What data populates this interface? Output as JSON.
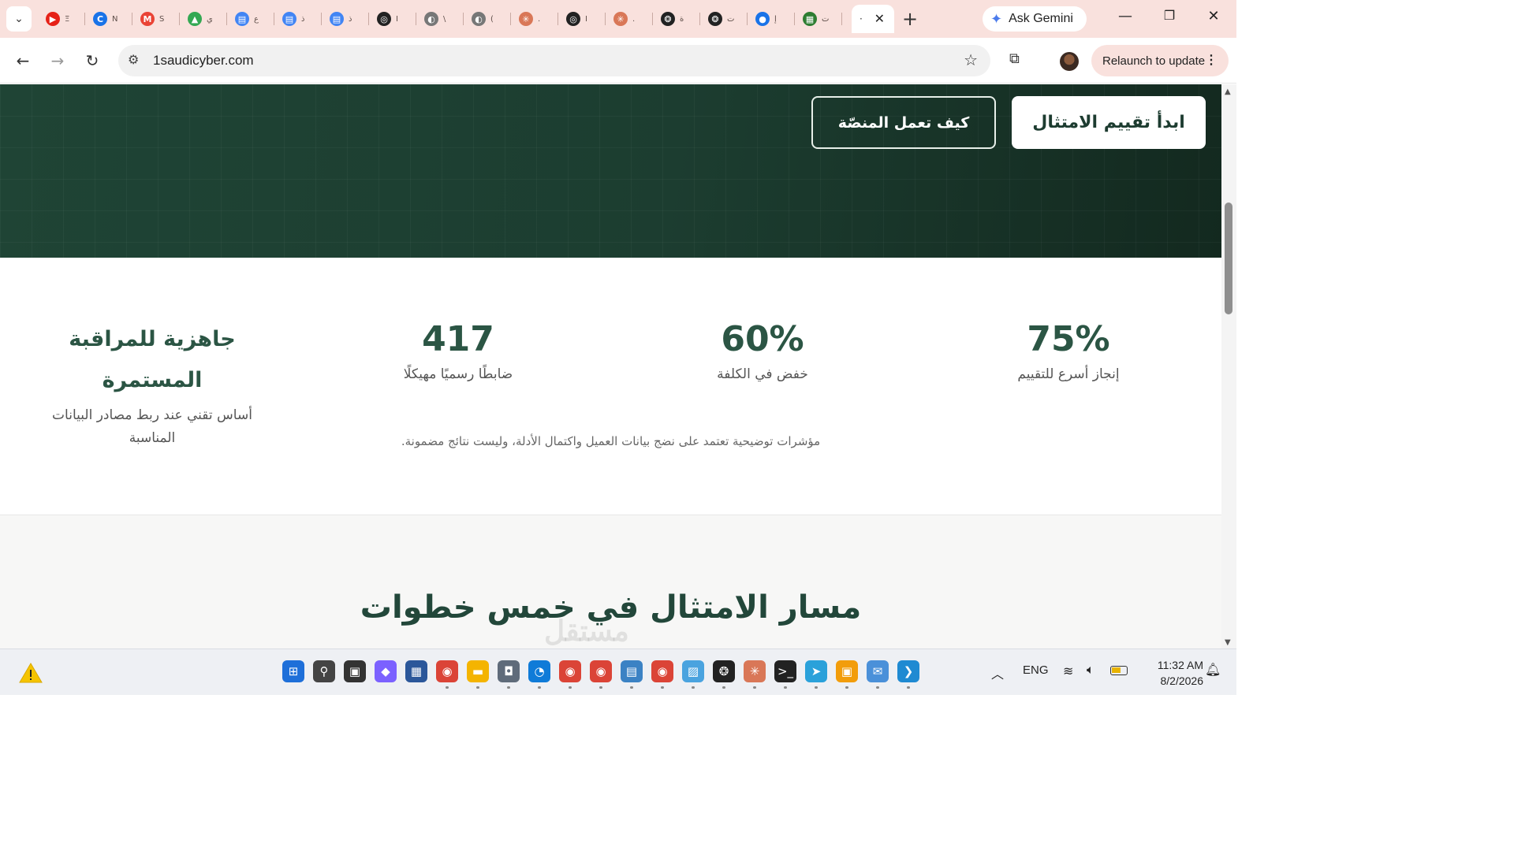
{
  "browser": {
    "tabs": [
      {
        "icon": "youtube-icon",
        "color": "#e62117",
        "glyph": "▶",
        "label": "Ξ"
      },
      {
        "icon": "c-icon",
        "color": "#1a73e8",
        "glyph": "C",
        "label": "N"
      },
      {
        "icon": "gmail-icon",
        "color": "#ea4335",
        "glyph": "M",
        "label": "S"
      },
      {
        "icon": "drive-icon",
        "color": "#34a853",
        "glyph": "▲",
        "label": "ي"
      },
      {
        "icon": "docs-icon",
        "color": "#4285f4",
        "glyph": "▤",
        "label": "ع"
      },
      {
        "icon": "docs-icon",
        "color": "#4285f4",
        "glyph": "▤",
        "label": "ذ"
      },
      {
        "icon": "docs-icon",
        "color": "#4285f4",
        "glyph": "▤",
        "label": "ذ"
      },
      {
        "icon": "chatgpt-icon",
        "color": "#222222",
        "glyph": "◎",
        "label": "I"
      },
      {
        "icon": "globe-icon",
        "color": "#777777",
        "glyph": "◐",
        "label": "\\"
      },
      {
        "icon": "globe-icon",
        "color": "#777777",
        "glyph": "◐",
        "label": "("
      },
      {
        "icon": "claude-icon",
        "color": "#d97757",
        "glyph": "✳",
        "label": "."
      },
      {
        "icon": "chatgpt-icon",
        "color": "#222222",
        "glyph": "◎",
        "label": "I"
      },
      {
        "icon": "claude-icon",
        "color": "#d97757",
        "glyph": "✳",
        "label": "."
      },
      {
        "icon": "openai-icon",
        "color": "#222222",
        "glyph": "❂",
        "label": "ﺓ"
      },
      {
        "icon": "openai-icon",
        "color": "#222222",
        "glyph": "❂",
        "label": "ت"
      },
      {
        "icon": "circle-icon",
        "color": "#1a73e8",
        "glyph": "●",
        "label": "إ"
      },
      {
        "icon": "news-icon",
        "color": "#2e7d32",
        "glyph": "▦",
        "label": "ت"
      }
    ],
    "active_tab_label": "·",
    "gemini_label": "Ask Gemini",
    "url": "1saudicyber.com",
    "relaunch_label": "Relaunch to update"
  },
  "hero": {
    "primary_button": "ابدأ تقييم الامتثال",
    "secondary_button": "كيف تعمل المنصّة"
  },
  "stats": {
    "items": [
      {
        "value": "75%",
        "label": "إنجاز أسرع للتقييم"
      },
      {
        "value": "60%",
        "label": "خفض في الكلفة"
      },
      {
        "value": "417",
        "label": "ضابطًا رسميًا مهيكلًا"
      },
      {
        "title": "جاهزية للمراقبة المستمرة",
        "label": "أساس تقني عند ربط مصادر البيانات المناسبة"
      }
    ],
    "note": "مؤشرات توضيحية تعتمد على نضج بيانات العميل واكتمال الأدلة، وليست نتائج مضمونة."
  },
  "steps": {
    "heading": "مسار الامتثال في خمس خطوات"
  },
  "watermark": "مستقل",
  "taskbar": {
    "icons": [
      {
        "name": "start-icon",
        "color": "#1e6fd9",
        "glyph": "⊞"
      },
      {
        "name": "search-icon",
        "color": "#444444",
        "glyph": "⚲"
      },
      {
        "name": "task-view-icon",
        "color": "#333333",
        "glyph": "▣"
      },
      {
        "name": "copilot-icon",
        "color": "#7b61ff",
        "glyph": "◆"
      },
      {
        "name": "store-icon",
        "color": "#2b579a",
        "glyph": "▦"
      },
      {
        "name": "chrome-icon",
        "color": "#db4437",
        "glyph": "◉"
      },
      {
        "name": "explorer-icon",
        "color": "#f4b400",
        "glyph": "▬"
      },
      {
        "name": "camera-icon",
        "color": "#5f6b7a",
        "glyph": "◘"
      },
      {
        "name": "edge-icon",
        "color": "#0f7bd8",
        "glyph": "◔"
      },
      {
        "name": "chrome-icon",
        "color": "#db4437",
        "glyph": "◉"
      },
      {
        "name": "chrome-icon",
        "color": "#db4437",
        "glyph": "◉"
      },
      {
        "name": "notepad-icon",
        "color": "#3b82c4",
        "glyph": "▤"
      },
      {
        "name": "chrome-icon",
        "color": "#db4437",
        "glyph": "◉"
      },
      {
        "name": "image-icon",
        "color": "#4aa3df",
        "glyph": "▨"
      },
      {
        "name": "chatgpt-icon",
        "color": "#222222",
        "glyph": "❂"
      },
      {
        "name": "claude-icon",
        "color": "#d97757",
        "glyph": "✳"
      },
      {
        "name": "terminal-icon",
        "color": "#222222",
        "glyph": ">_"
      },
      {
        "name": "telegram-icon",
        "color": "#2aa1da",
        "glyph": "➤"
      },
      {
        "name": "remote-desktop-icon",
        "color": "#f29d0b",
        "glyph": "▣"
      },
      {
        "name": "mail-icon",
        "color": "#4a90d9",
        "glyph": "✉"
      },
      {
        "name": "vscode-icon",
        "color": "#1f8ad2",
        "glyph": "❯"
      }
    ],
    "language": "ENG",
    "time": "11:32 AM",
    "date": "8/2/2026"
  }
}
